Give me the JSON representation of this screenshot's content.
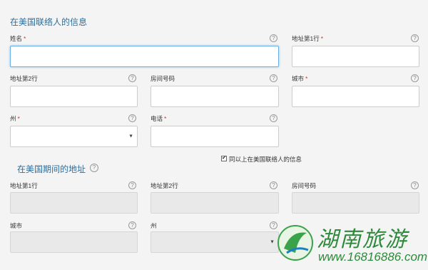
{
  "section1": {
    "title": "在美国联络人的信息"
  },
  "fields1": {
    "name": {
      "label": "姓名",
      "required": true
    },
    "addr1": {
      "label": "地址第1行",
      "required": true
    },
    "addr2": {
      "label": "地址第2行",
      "required": false
    },
    "room": {
      "label": "房间号码",
      "required": false
    },
    "city": {
      "label": "城市",
      "required": true
    },
    "state": {
      "label": "州",
      "required": true
    },
    "phone": {
      "label": "电话",
      "required": true
    }
  },
  "same_as_above": {
    "label": "同以上在美国联络人的信息",
    "checked": true
  },
  "section2": {
    "title": "在美国期间的地址"
  },
  "fields2": {
    "addr1": {
      "label": "地址第1行"
    },
    "addr2": {
      "label": "地址第2行"
    },
    "room": {
      "label": "房间号码"
    },
    "city": {
      "label": "城市"
    },
    "state": {
      "label": "州"
    }
  },
  "common": {
    "required_mark": "*",
    "help_glyph": "?",
    "check_glyph": "✔",
    "caret_glyph": "▼"
  },
  "watermark": {
    "brand": "湖南旅游",
    "url": "www.16816886.com"
  },
  "colors": {
    "accent": "#2f6e9a",
    "required": "#c0392b",
    "focus": "#66afe9",
    "watermark": "#2d8a3a"
  }
}
